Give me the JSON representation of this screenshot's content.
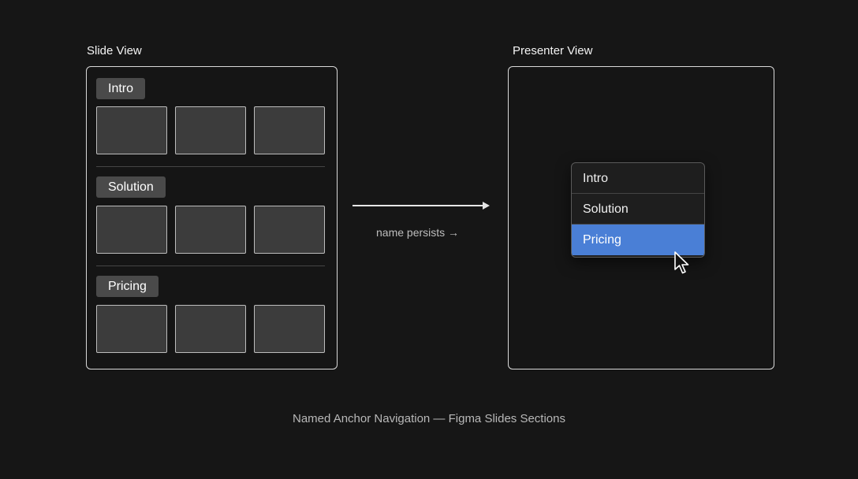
{
  "left_panel": {
    "title": "Slide View",
    "sections": [
      {
        "label": "Intro",
        "thumbnail_count": 3
      },
      {
        "label": "Solution",
        "thumbnail_count": 3
      },
      {
        "label": "Pricing",
        "thumbnail_count": 3
      }
    ]
  },
  "arrow": {
    "caption": "name persists →"
  },
  "right_panel": {
    "title": "Presenter View",
    "menu": {
      "items": [
        "Intro",
        "Solution",
        "Pricing"
      ],
      "selected": "Pricing"
    }
  },
  "footer": {
    "caption": "Named Anchor Navigation — Figma Slides Sections"
  },
  "colors": {
    "background": "#161616",
    "selected": "#4a7fd6",
    "thumbnail": "#3c3c3c",
    "section_label": "#4a4a4a"
  },
  "icons": {
    "cursor": "pointer-cursor-icon"
  }
}
